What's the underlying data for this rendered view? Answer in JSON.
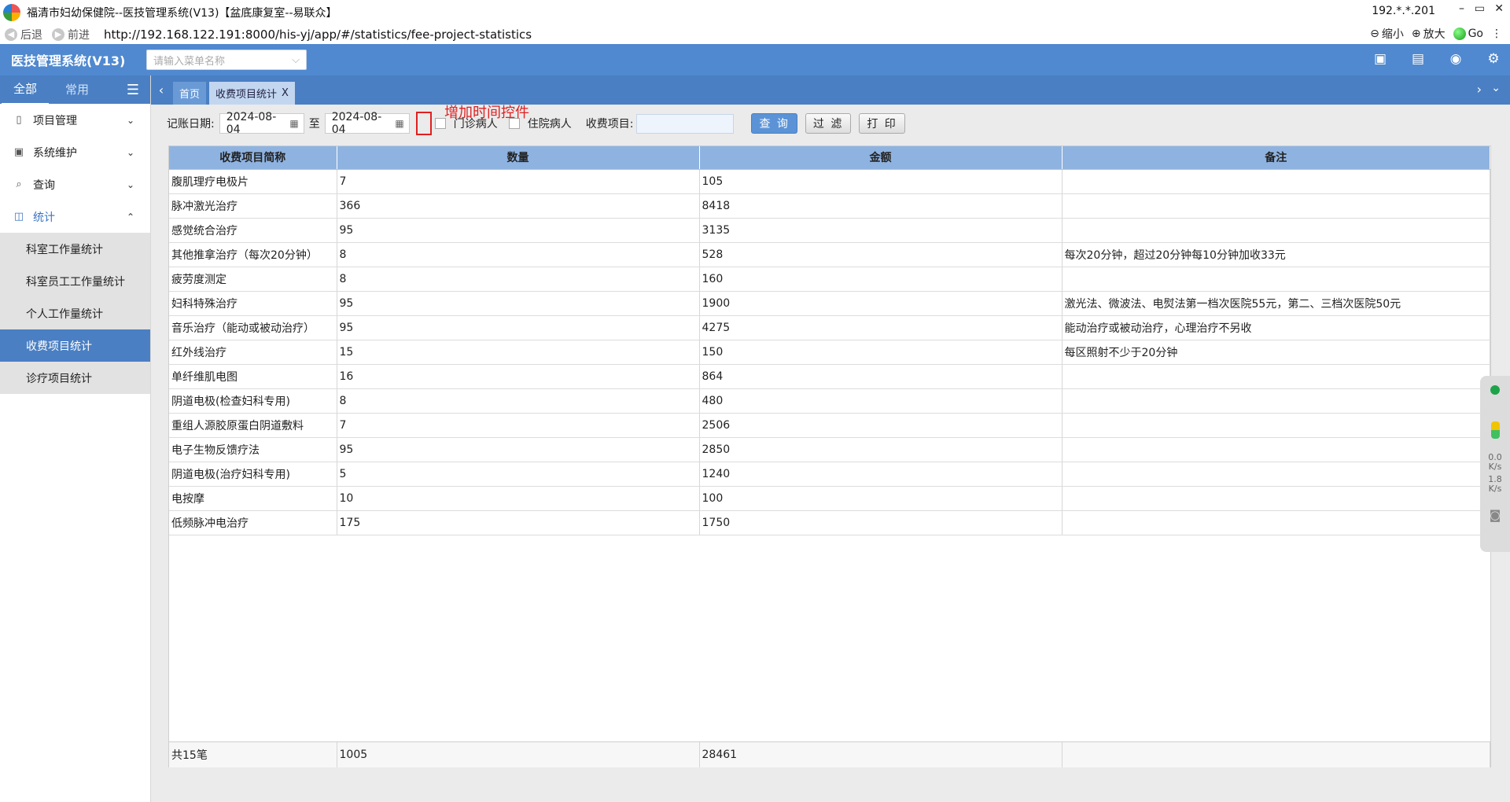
{
  "window": {
    "title": "福清市妇幼保健院--医技管理系统(V13)【盆底康复室--易联众】",
    "ip": "192.*.*.201",
    "minimize": "–",
    "restore": "▭",
    "close": "✕"
  },
  "browser": {
    "back_label": "后退",
    "forward_label": "前进",
    "url": "http://192.168.122.191:8000/his-yj/app/#/statistics/fee-project-statistics",
    "zoom_out_label": "缩小",
    "zoom_in_label": "放大",
    "go_label": "Go"
  },
  "header": {
    "system_name": "医技管理系统(V13)",
    "menu_search_placeholder": "请输入菜单名称"
  },
  "sidebar": {
    "tabs": [
      "全部",
      "常用"
    ],
    "items": [
      {
        "label": "项目管理",
        "icon": "doc-icon"
      },
      {
        "label": "系统维护",
        "icon": "monitor-icon"
      },
      {
        "label": "查询",
        "icon": "search-icon"
      },
      {
        "label": "统计",
        "icon": "chart-icon"
      }
    ],
    "sub_items": [
      "科室工作量统计",
      "科室员工工作量统计",
      "个人工作量统计",
      "收费项目统计",
      "诊疗项目统计"
    ]
  },
  "tabs": {
    "home": "首页",
    "current": "收费项目统计",
    "close": "X"
  },
  "filters": {
    "date_label": "记账日期:",
    "start_date": "2024-08-04",
    "to_label": "至",
    "end_date": "2024-08-04",
    "annotation": "增加时间控件",
    "outpatient_label": "门诊病人",
    "inpatient_label": "住院病人",
    "fee_item_label": "收费项目:",
    "query_button": "查 询",
    "filter_button": "过 滤",
    "print_button": "打 印"
  },
  "table": {
    "columns": [
      "收费项目简称",
      "数量",
      "金额",
      "备注"
    ],
    "rows": [
      [
        "腹肌理疗电极片",
        "7",
        "105",
        ""
      ],
      [
        "脉冲激光治疗",
        "366",
        "8418",
        ""
      ],
      [
        "感觉统合治疗",
        "95",
        "3135",
        ""
      ],
      [
        "其他推拿治疗（每次20分钟）",
        "8",
        "528",
        "每次20分钟，超过20分钟每10分钟加收33元"
      ],
      [
        "疲劳度测定",
        "8",
        "160",
        ""
      ],
      [
        "妇科特殊治疗",
        "95",
        "1900",
        "激光法、微波法、电熨法第一档次医院55元，第二、三档次医院50元"
      ],
      [
        "音乐治疗（能动或被动治疗）",
        "95",
        "4275",
        "能动治疗或被动治疗，心理治疗不另收"
      ],
      [
        "红外线治疗",
        "15",
        "150",
        "每区照射不少于20分钟"
      ],
      [
        "单纤维肌电图",
        "16",
        "864",
        ""
      ],
      [
        "阴道电极(检查妇科专用)",
        "8",
        "480",
        ""
      ],
      [
        "重组人源胶原蛋白阴道敷料",
        "7",
        "2506",
        ""
      ],
      [
        "电子生物反馈疗法",
        "95",
        "2850",
        ""
      ],
      [
        "阴道电极(治疗妇科专用)",
        "5",
        "1240",
        ""
      ],
      [
        "电按摩",
        "10",
        "100",
        ""
      ],
      [
        "低频脉冲电治疗",
        "175",
        "1750",
        ""
      ]
    ],
    "footer": [
      "共15笔",
      "1005",
      "28461",
      ""
    ]
  },
  "floatbar": {
    "up_speed": "0.0",
    "down_speed": "1.8",
    "unit": "K/s"
  }
}
